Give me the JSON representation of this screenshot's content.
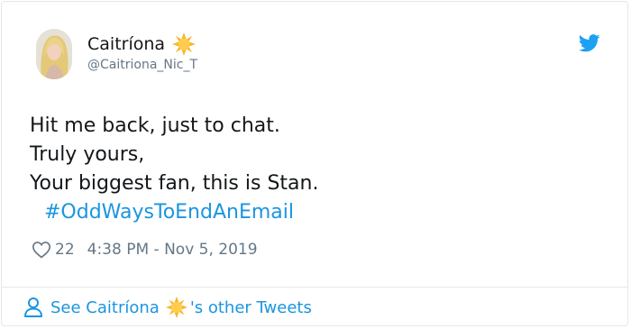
{
  "tweet": {
    "author": {
      "display_name": "Caitríona",
      "emoji_icon": "sun-emoji-icon",
      "handle": "@Caitriona_Nic_T"
    },
    "lines": [
      "Hit me back, just to chat.",
      "Truly yours,",
      "Your biggest fan, this is Stan."
    ],
    "hashtag": "#OddWaysToEndAnEmail",
    "likes": "22",
    "timestamp": "4:38 PM - Nov 5, 2019"
  },
  "footer": {
    "prefix": "See Caitríona",
    "suffix": "'s other Tweets"
  },
  "colors": {
    "link": "#1b95e0",
    "muted": "#657786",
    "text": "#14171a",
    "border": "#e1e8ed"
  },
  "icons": [
    "twitter-bird-icon",
    "heart-icon",
    "person-icon",
    "sun-emoji-icon"
  ]
}
